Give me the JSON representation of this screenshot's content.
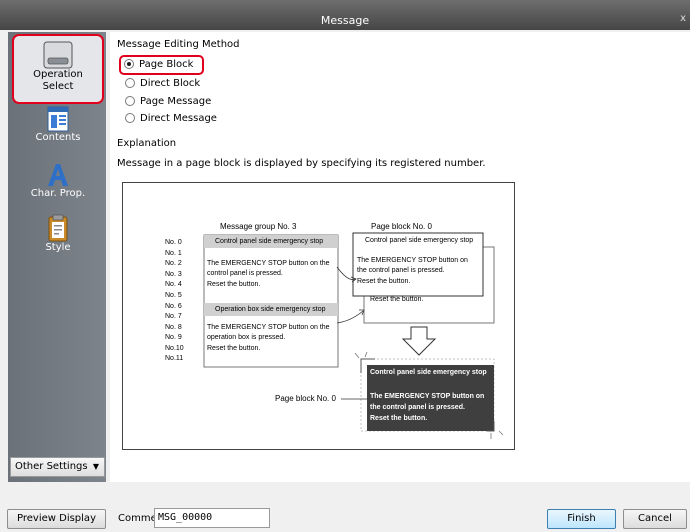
{
  "window": {
    "title": "Message",
    "close_glyph": "x"
  },
  "sidebar": {
    "items": [
      {
        "label1": "Operation",
        "label2": "Select",
        "icon": "operation-select-icon",
        "active": true
      },
      {
        "label1": "Contents",
        "icon": "contents-icon"
      },
      {
        "label1": "Char. Prop.",
        "icon": "char-prop-icon"
      },
      {
        "label1": "Style",
        "icon": "style-icon"
      }
    ],
    "other_settings": "Other Settings"
  },
  "main": {
    "method_heading": "Message Editing Method",
    "options": [
      {
        "label": "Page Block",
        "selected": true
      },
      {
        "label": "Direct Block",
        "selected": false
      },
      {
        "label": "Page Message",
        "selected": false
      },
      {
        "label": "Direct Message",
        "selected": false
      }
    ],
    "explanation_heading": "Explanation",
    "explanation_text": "Message in a page block is displayed by specifying its registered number."
  },
  "diagram": {
    "group_title": "Message group No. 3",
    "page_block_title": "Page block No. 0",
    "row_numbers": [
      "No. 0",
      "No. 1",
      "No. 2",
      "No. 3",
      "No. 4",
      "No. 5",
      "No. 6",
      "No. 7",
      "No. 8",
      "No. 9",
      "No.10",
      "No.11"
    ],
    "group_msg1_title": "Control panel side emergency stop",
    "group_msg1_l1": "The EMERGENCY STOP button on the",
    "group_msg1_l2": "control panel is pressed.",
    "group_msg1_l3": "Reset the button.",
    "group_msg2_title": "Operation box side emergency stop",
    "group_msg2_l1": "The EMERGENCY STOP button on the",
    "group_msg2_l2": "operation box is pressed.",
    "group_msg2_l3": "Reset the button.",
    "block_title": "Control panel side emergency stop",
    "block_l1": "The EMERGENCY STOP button on",
    "block_l2": "the control panel is pressed.",
    "block_l3": "Reset the button.",
    "block_back_text": "Reset the button.",
    "screen_label": "Page block No. 0",
    "screen_title": "Control panel side emergency stop",
    "screen_l1": "The EMERGENCY STOP button on",
    "screen_l2": "the control panel is pressed.",
    "screen_l3": "Reset the button."
  },
  "bottom": {
    "preview_label": "Preview Display",
    "comment_label": "Comme",
    "comment_value": "MSG_00000",
    "finish_label": "Finish",
    "cancel_label": "Cancel"
  },
  "colors": {
    "highlight": "#e0001b",
    "sidebar": "#747b83",
    "titlebar": "#505050"
  }
}
